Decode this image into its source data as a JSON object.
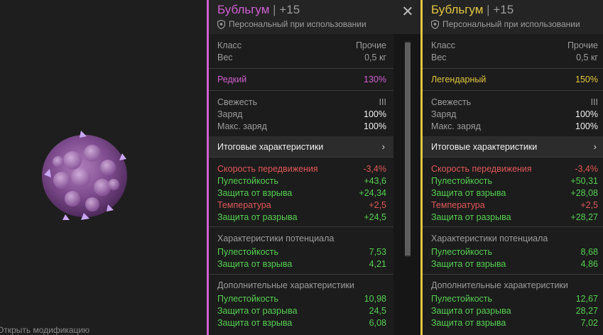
{
  "preview": {
    "caption": "Открыть модификацию",
    "artifact_icon": "bubblegum-artifact-icon"
  },
  "colors": {
    "rare": "#cf5fd1",
    "legendary": "#e3c73f",
    "positive": "#55d051",
    "negative": "#e05757"
  },
  "panels": [
    {
      "title": "Бубльгум",
      "separator": "|",
      "level": "+15",
      "subtitle": "Персональный при использовании",
      "class_label": "Класс",
      "class_value": "Прочие",
      "weight_label": "Вес",
      "weight_value": "0,5 кг",
      "rarity_label": "Редкий",
      "rarity_value": "130%",
      "freshness_label": "Свежесть",
      "freshness_value": "III",
      "charge_label": "Заряд",
      "charge_value": "100%",
      "maxcharge_label": "Макс. заряд",
      "maxcharge_value": "100%",
      "summary_label": "Итоговые характеристики",
      "summary": [
        {
          "label": "Скорость передвижения",
          "value": "-3,4%"
        },
        {
          "label": "Пулестойкость",
          "value": "+43,6"
        },
        {
          "label": "Защита от взрыва",
          "value": "+24,34"
        },
        {
          "label": "Температура",
          "value": "+2,5"
        },
        {
          "label": "Защита от разрыва",
          "value": "+24,5"
        }
      ],
      "potential_label": "Характеристики потенциала",
      "potential": [
        {
          "label": "Пулестойкость",
          "value": "7,53"
        },
        {
          "label": "Защита от взрыва",
          "value": "4,21"
        }
      ],
      "extra_label": "Дополнительные характеристики",
      "extra": [
        {
          "label": "Пулестойкость",
          "value": "10,98"
        },
        {
          "label": "Защита от разрыва",
          "value": "24,5"
        },
        {
          "label": "Защита от взрыва",
          "value": "6,08"
        }
      ]
    },
    {
      "title": "Бубльгум",
      "separator": "|",
      "level": "+15",
      "subtitle": "Персональный при использовании",
      "class_label": "Класс",
      "class_value": "Прочие",
      "weight_label": "Вес",
      "weight_value": "0,5 кг",
      "rarity_label": "Легендарный",
      "rarity_value": "150%",
      "freshness_label": "Свежесть",
      "freshness_value": "III",
      "charge_label": "Заряд",
      "charge_value": "100%",
      "maxcharge_label": "Макс. заряд",
      "maxcharge_value": "100%",
      "summary_label": "Итоговые характеристики",
      "summary": [
        {
          "label": "Скорость передвижения",
          "value": "-3,4%"
        },
        {
          "label": "Пулестойкость",
          "value": "+50,31"
        },
        {
          "label": "Защита от взрыва",
          "value": "+28,08"
        },
        {
          "label": "Температура",
          "value": "+2,5"
        },
        {
          "label": "Защита от разрыва",
          "value": "+28,27"
        }
      ],
      "potential_label": "Характеристики потенциала",
      "potential": [
        {
          "label": "Пулестойкость",
          "value": "8,68"
        },
        {
          "label": "Защита от взрыва",
          "value": "4,86"
        }
      ],
      "extra_label": "Дополнительные характеристики",
      "extra": [
        {
          "label": "Пулестойкость",
          "value": "12,67"
        },
        {
          "label": "Защита от разрыва",
          "value": "28,27"
        },
        {
          "label": "Защита от взрыва",
          "value": "7,02"
        }
      ]
    }
  ]
}
